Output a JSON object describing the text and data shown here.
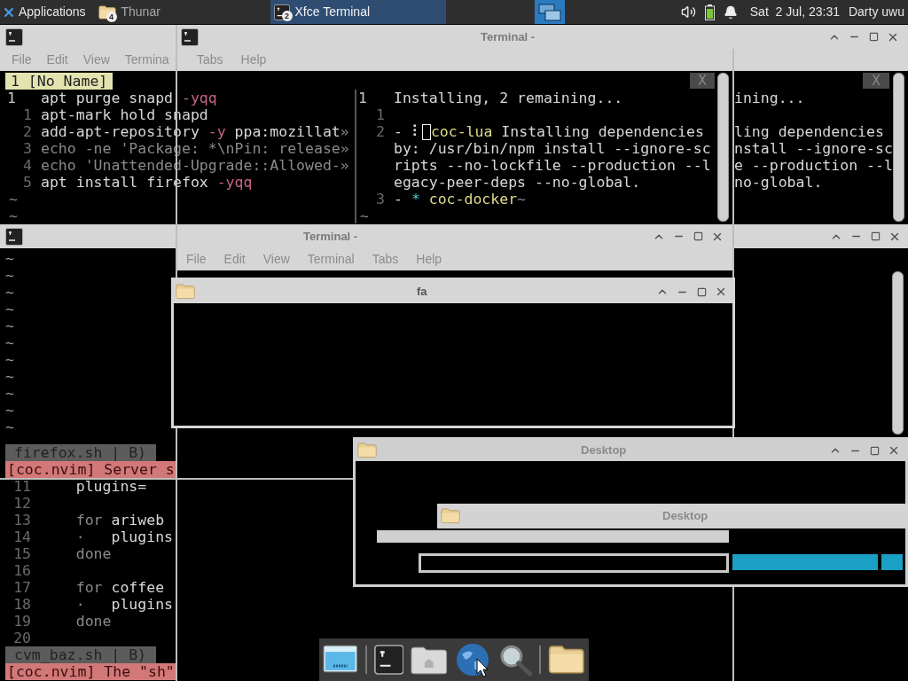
{
  "panel": {
    "applications": "Applications",
    "tasks": [
      {
        "label": "Thunar",
        "badge": "4",
        "kind": "folder",
        "selected": false
      },
      {
        "label": "Xfce Terminal",
        "badge": "2",
        "kind": "terminal",
        "selected": true
      }
    ],
    "clock": "Sat  2 Jul, 23:31",
    "user": "Darty uwu"
  },
  "top_terminal": {
    "back_menu": [
      "File",
      "Edit",
      "View",
      "Termina"
    ],
    "title": "Terminal -",
    "menu": [
      "Tabs",
      "Help"
    ],
    "vim_tab": "1 [No Name]",
    "close_labels": [
      "X",
      "X"
    ],
    "left_lines": [
      {
        "number": "1",
        "kind": "current",
        "segments": [
          {
            "kind": "text",
            "text": "apt purge snapd "
          },
          {
            "kind": "flag",
            "text": "-yqq"
          }
        ]
      },
      {
        "number": "1",
        "kind": "plain",
        "segments": [
          {
            "kind": "text",
            "text": "apt-mark hold snapd"
          }
        ]
      },
      {
        "number": "2",
        "kind": "plain",
        "segments": [
          {
            "kind": "text",
            "text": "add-apt-repository "
          },
          {
            "kind": "flag",
            "text": "-y"
          },
          {
            "kind": "text",
            "text": " ppa:mozillat"
          },
          {
            "kind": "dim",
            "text": "»"
          }
        ]
      },
      {
        "number": "3",
        "kind": "plain",
        "segments": [
          {
            "kind": "dim",
            "text": "echo -ne 'Package: *\\nPin: release»"
          }
        ]
      },
      {
        "number": "4",
        "kind": "plain",
        "segments": [
          {
            "kind": "dim",
            "text": "echo 'Unattended-Upgrade::Allowed-»"
          }
        ]
      },
      {
        "number": "5",
        "kind": "plain",
        "segments": [
          {
            "kind": "text",
            "text": "apt install firefox "
          },
          {
            "kind": "flag",
            "text": "-yqq"
          }
        ]
      },
      {
        "kind": "tilde",
        "segments": [
          {
            "kind": "dim",
            "text": "~"
          }
        ]
      },
      {
        "kind": "tilde",
        "segments": [
          {
            "kind": "dim",
            "text": "~"
          }
        ]
      }
    ],
    "right_lines": [
      {
        "number": "1",
        "kind": "current",
        "segments": [
          {
            "kind": "text",
            "text": "Installing, 2 remaining..."
          }
        ]
      },
      {
        "number": "1",
        "kind": "plain"
      },
      {
        "number": "2",
        "kind": "plain",
        "segments": [
          {
            "kind": "text",
            "text": "- "
          },
          {
            "kind": "spinner",
            "text": "⠇"
          },
          {
            "kind": "cursor"
          },
          {
            "kind": "name",
            "text": "coc-lua"
          },
          {
            "kind": "text",
            "text": " Installing dependencies"
          }
        ]
      },
      {
        "kind": "wrap",
        "segments": [
          {
            "kind": "text",
            "text": "by: /usr/bin/npm install --ignore-sc"
          }
        ]
      },
      {
        "kind": "wrap",
        "segments": [
          {
            "kind": "text",
            "text": "ripts --no-lockfile --production --l"
          }
        ]
      },
      {
        "kind": "wrap",
        "segments": [
          {
            "kind": "text",
            "text": "egacy-peer-deps --no-global."
          }
        ]
      },
      {
        "number": "3",
        "kind": "plain",
        "segments": [
          {
            "kind": "text",
            "text": "- "
          },
          {
            "kind": "star",
            "text": "*"
          },
          {
            "kind": "name",
            "text": " coc-docker"
          },
          {
            "kind": "dim",
            "text": "~"
          }
        ]
      },
      {
        "kind": "tilde",
        "segments": [
          {
            "kind": "dim",
            "text": "~"
          }
        ]
      }
    ],
    "clipped_lines": [
      {
        "kind": "text",
        "text": "ining..."
      },
      {
        "kind": "blank"
      },
      {
        "kind": "text",
        "text": "ling dependencies"
      },
      {
        "kind": "text",
        "text": "nstall --ignore-sc"
      },
      {
        "kind": "text",
        "text": "e --production --l"
      },
      {
        "kind": "text",
        "text": "no-global."
      }
    ]
  },
  "middle_terminal": {
    "title": "Terminal -",
    "menu": [
      "File",
      "Edit",
      "View",
      "Terminal",
      "Tabs",
      "Help"
    ]
  },
  "file_window": {
    "title": "fa"
  },
  "side_vim": {
    "tildes": [
      "~",
      "~",
      "~",
      "~",
      "~",
      "~",
      "~",
      "~",
      "~",
      "~",
      "~"
    ],
    "blocks": [
      {
        "status": "firefox.sh | B)",
        "message": "[coc.nvim] Server s",
        "lines": [
          {
            "number": "11",
            "segments": [
              {
                "kind": "text",
                "text": "    plugins="
              }
            ]
          },
          {
            "number": "12"
          },
          {
            "number": "13",
            "segments": [
              {
                "kind": "dim",
                "text": "    for "
              },
              {
                "kind": "text",
                "text": "ariweb"
              }
            ]
          },
          {
            "number": "14",
            "segments": [
              {
                "kind": "dim",
                "text": "    ·   "
              },
              {
                "kind": "text",
                "text": "plugins"
              }
            ]
          },
          {
            "number": "15",
            "segments": [
              {
                "kind": "dim",
                "text": "    done"
              }
            ]
          },
          {
            "number": "16"
          },
          {
            "number": "17",
            "segments": [
              {
                "kind": "dim",
                "text": "    for "
              },
              {
                "kind": "text",
                "text": "coffee"
              }
            ]
          },
          {
            "number": "18",
            "segments": [
              {
                "kind": "dim",
                "text": "    ·   "
              },
              {
                "kind": "text",
                "text": "plugins"
              }
            ]
          },
          {
            "number": "19",
            "segments": [
              {
                "kind": "dim",
                "text": "    done"
              }
            ]
          },
          {
            "number": "20"
          }
        ]
      },
      {
        "status": "cvm_baz.sh | B)",
        "message": "[coc.nvim] The \"sh\""
      }
    ]
  },
  "desktop_windows": [
    {
      "title": "Desktop"
    },
    {
      "title": "Desktop"
    }
  ]
}
